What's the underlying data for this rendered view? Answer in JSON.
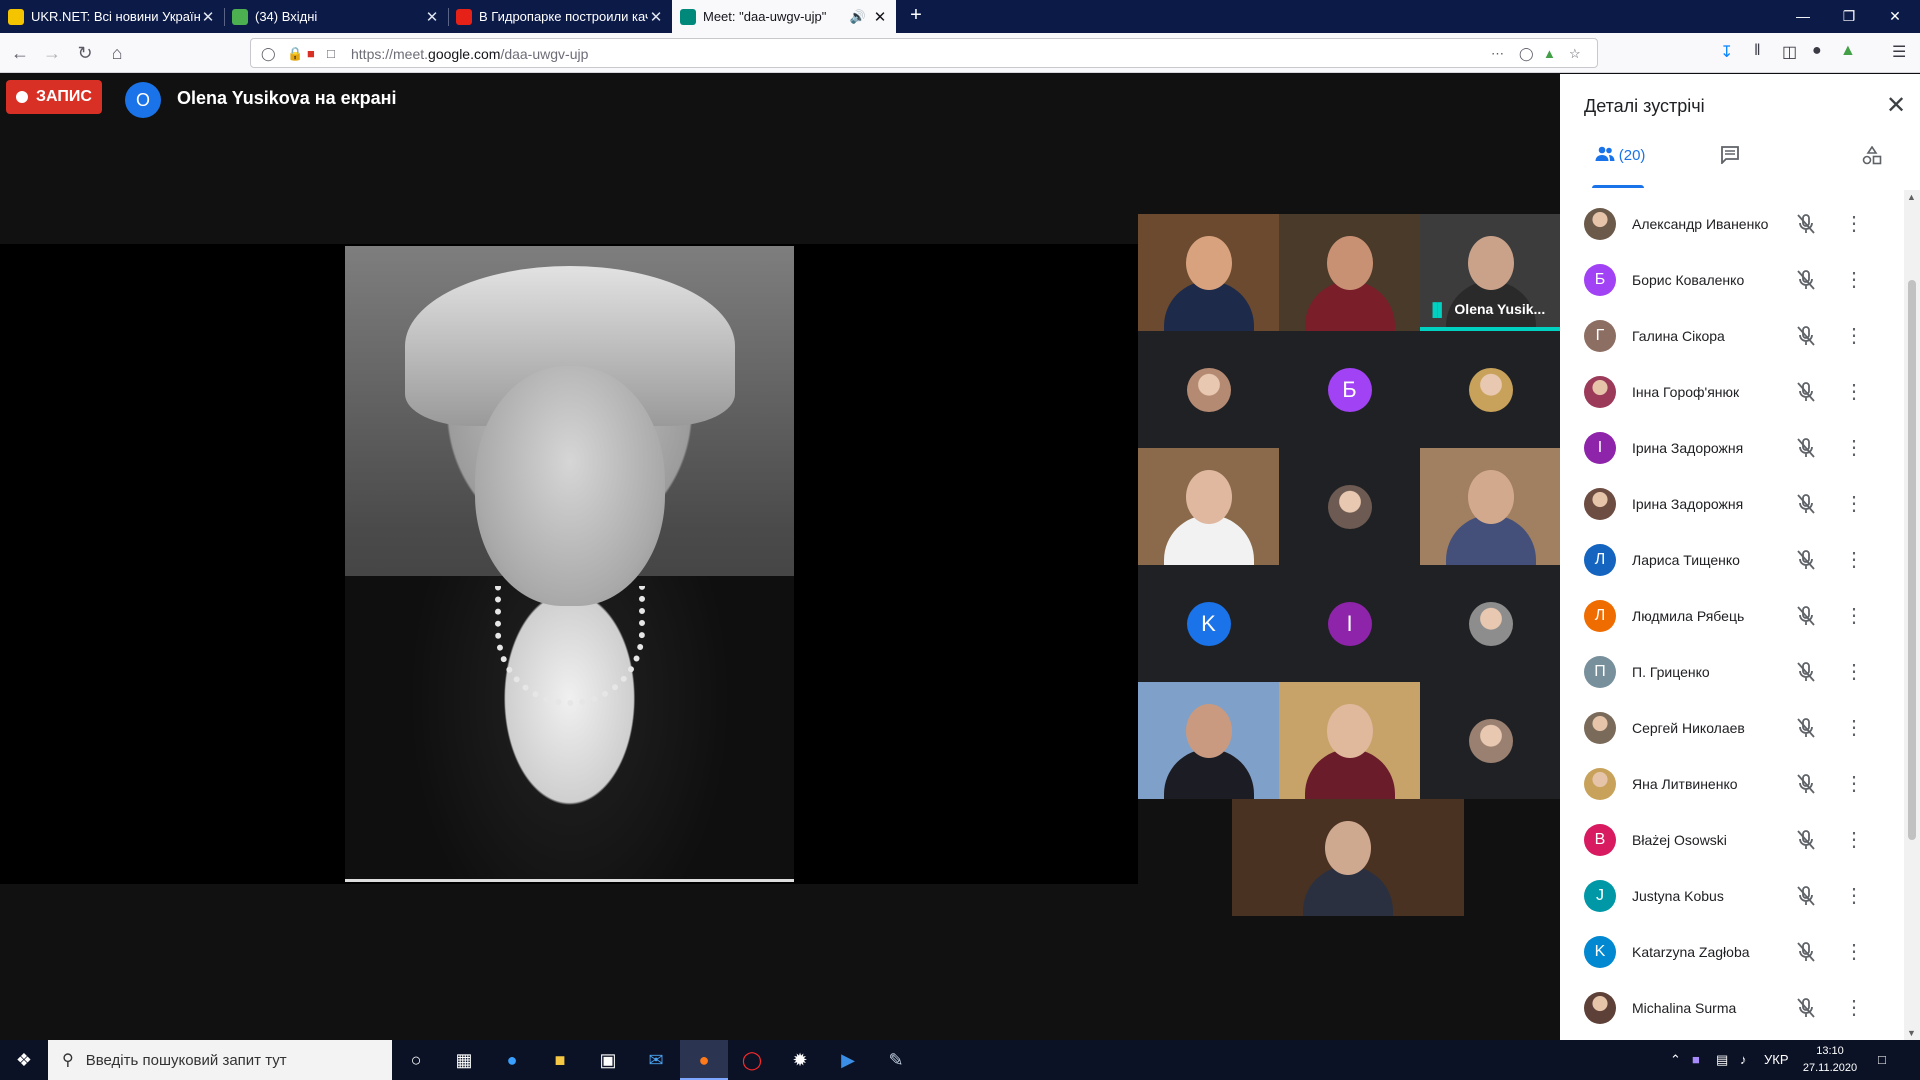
{
  "browser": {
    "tabs": [
      {
        "title": "UKR.NET: Всі новини України,",
        "favicon_color": "#f5c400",
        "active": false
      },
      {
        "title": "(34) Вхідні",
        "favicon_color": "#4caf50",
        "active": false
      },
      {
        "title": "В Гидропарке построили кача",
        "favicon_color": "#e62117",
        "active": false
      },
      {
        "title": "Meet: \"daa-uwgv-ujp\"",
        "favicon_color": "#00897b",
        "active": true
      }
    ],
    "url_prefix": "https://meet.",
    "url_host": "google.com",
    "url_path": "/daa-uwgv-ujp"
  },
  "meet": {
    "recording_label": "ЗАПИС",
    "presenter_initial": "O",
    "presenter_text": "Olena Yusikova на екрані",
    "tiles": [
      {
        "kind": "video",
        "bg": "#6b4a2f",
        "skin": "#d9a27e",
        "shirt": "#1d2a4a"
      },
      {
        "kind": "video",
        "bg": "#4a3a2a",
        "skin": "#c99174",
        "shirt": "#7a1e2a"
      },
      {
        "kind": "video",
        "bg": "#3c3c3c",
        "skin": "#caa28a",
        "shirt": "#2a2a2a",
        "name": "Olena Yusik...",
        "speaking": true
      },
      {
        "kind": "photo",
        "color": "#b58a72"
      },
      {
        "kind": "initial",
        "initial": "Б",
        "color": "#a142f4"
      },
      {
        "kind": "photo",
        "color": "#c8a25a"
      },
      {
        "kind": "video",
        "bg": "#8a6a4a",
        "skin": "#e0b8a0",
        "shirt": "#f2f2f2"
      },
      {
        "kind": "photo",
        "color": "#6d5a52"
      },
      {
        "kind": "video",
        "bg": "#a08060",
        "skin": "#d2a98c",
        "shirt": "#44507a"
      },
      {
        "kind": "initial",
        "initial": "K",
        "color": "#1a73e8"
      },
      {
        "kind": "initial",
        "initial": "І",
        "color": "#8e24aa"
      },
      {
        "kind": "photo",
        "color": "#8d8d8d"
      },
      {
        "kind": "video",
        "bg": "#7fa0c8",
        "skin": "#c99a80",
        "shirt": "#1c1c24"
      },
      {
        "kind": "video",
        "bg": "#c7a36a",
        "skin": "#e0b89c",
        "shirt": "#6a1c2a"
      },
      {
        "kind": "photo",
        "color": "#9a8070"
      },
      {
        "kind": "video",
        "bg": "#4a3222",
        "skin": "#cfa890",
        "shirt": "#2a3040"
      }
    ]
  },
  "panel": {
    "title": "Деталі зустрічі",
    "people_count": "(20)",
    "participants": [
      {
        "name": "Александр Иваненко",
        "initial": "",
        "color": "#6b5a4a"
      },
      {
        "name": "Борис Коваленко",
        "initial": "Б",
        "color": "#a142f4"
      },
      {
        "name": "Галина Сікора",
        "initial": "Г",
        "color": "#8d6e63"
      },
      {
        "name": "Інна Гороф'янюк",
        "initial": "",
        "color": "#9c3a5a"
      },
      {
        "name": "Ірина Задорожня",
        "initial": "І",
        "color": "#8e24aa"
      },
      {
        "name": "Ірина Задорожня",
        "initial": "",
        "color": "#6d4c41"
      },
      {
        "name": "Лариса Тищенко",
        "initial": "Л",
        "color": "#1565c0"
      },
      {
        "name": "Людмила Рябець",
        "initial": "Л",
        "color": "#ef6c00"
      },
      {
        "name": "П. Гриценко",
        "initial": "П",
        "color": "#78909c"
      },
      {
        "name": "Сергей Николаев",
        "initial": "",
        "color": "#7a6a5a"
      },
      {
        "name": "Яна Литвиненко",
        "initial": "",
        "color": "#c8a25a"
      },
      {
        "name": "Błażej Osowski",
        "initial": "B",
        "color": "#d81b60"
      },
      {
        "name": "Justyna Kobus",
        "initial": "J",
        "color": "#0097a7"
      },
      {
        "name": "Katarzyna Zagłoba",
        "initial": "K",
        "color": "#0288d1"
      },
      {
        "name": "Michalina Surma",
        "initial": "",
        "color": "#5d4037"
      }
    ]
  },
  "taskbar": {
    "search_placeholder": "Введіть пошуковий запит тут",
    "language": "УКР",
    "time": "13:10",
    "date": "27.11.2020"
  }
}
